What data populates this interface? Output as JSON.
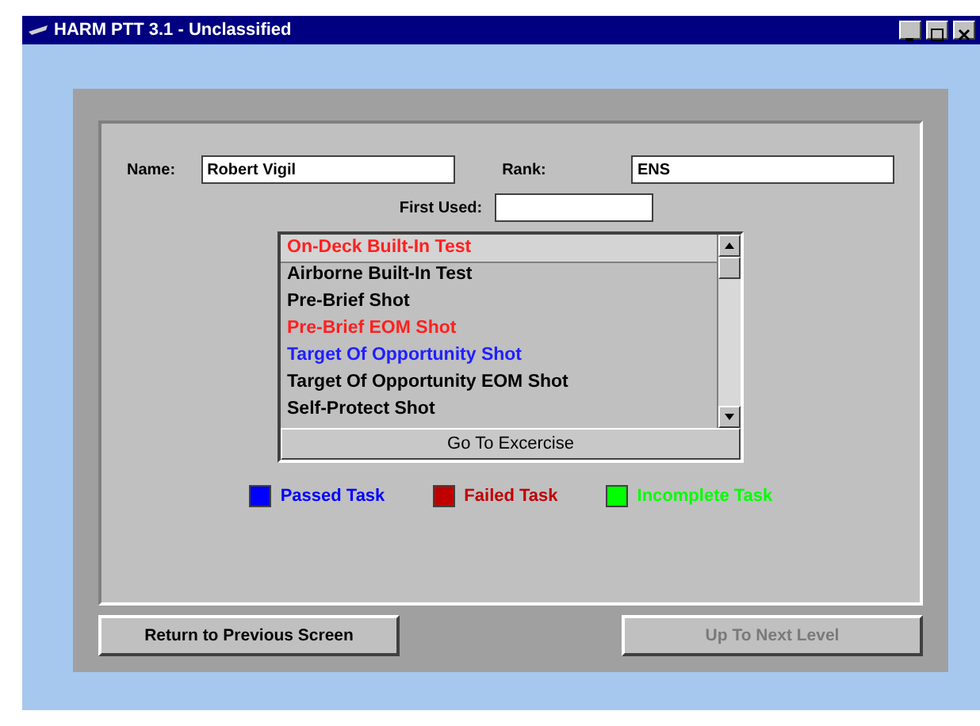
{
  "window": {
    "title": "HARM PTT 3.1 - Unclassified"
  },
  "form": {
    "name_label": "Name:",
    "name_value": "Robert Vigil",
    "rank_label": "Rank:",
    "rank_value": "ENS",
    "first_used_label": "First Used:"
  },
  "tasks": [
    {
      "label": "On-Deck Built-In Test",
      "color": "#ff2020",
      "selected": true
    },
    {
      "label": "Airborne Built-In Test",
      "color": "#000000",
      "selected": false
    },
    {
      "label": "Pre-Brief Shot",
      "color": "#000000",
      "selected": false
    },
    {
      "label": "Pre-Brief EOM Shot",
      "color": "#ff2020",
      "selected": false
    },
    {
      "label": "Target Of Opportunity Shot",
      "color": "#2020ff",
      "selected": false
    },
    {
      "label": "Target Of Opportunity EOM Shot",
      "color": "#000000",
      "selected": false
    },
    {
      "label": "Self-Protect Shot",
      "color": "#000000",
      "selected": false
    }
  ],
  "go_button": "Go To Excercise",
  "legend": [
    {
      "label": "Passed Task",
      "color": "#0000ff"
    },
    {
      "label": "Failed Task",
      "color": "#c00000"
    },
    {
      "label": "Incomplete Task",
      "color": "#00ff00"
    }
  ],
  "buttons": [
    {
      "label": "Return to Previous Screen",
      "disabled": false
    },
    {
      "label": "Up To Next Level",
      "disabled": true
    }
  ]
}
